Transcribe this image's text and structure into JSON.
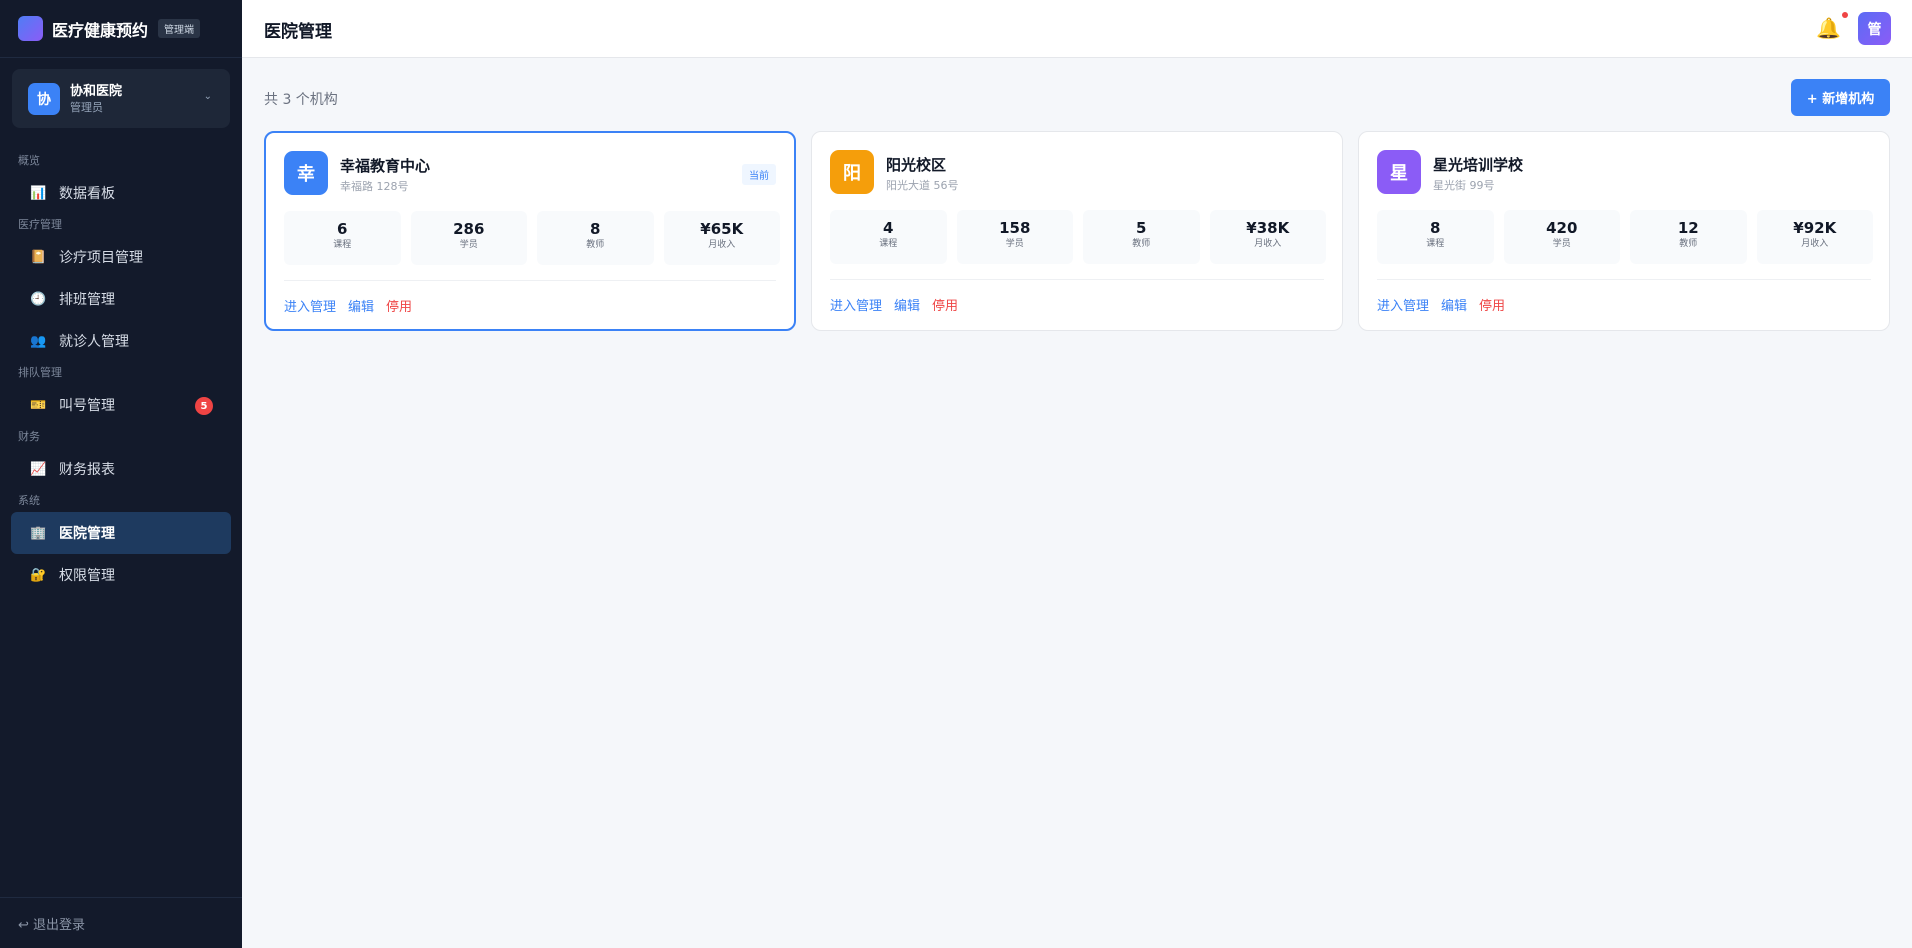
{
  "brand": {
    "name": "医疗健康预约",
    "tag": "管理端"
  },
  "org": {
    "avatar": "协",
    "name": "协和医院",
    "role": "管理员",
    "caret": "⌄"
  },
  "nav": {
    "groups": [
      {
        "label": "概览",
        "items": [
          {
            "icon": "📊",
            "icon_name": "chart-icon",
            "label": "数据看板"
          }
        ]
      },
      {
        "label": "医疗管理",
        "items": [
          {
            "icon": "📔",
            "icon_name": "notebook-icon",
            "label": "诊疗项目管理"
          },
          {
            "icon": "🕘",
            "icon_name": "clock-icon",
            "label": "排班管理"
          },
          {
            "icon": "👥",
            "icon_name": "users-icon",
            "label": "就诊人管理"
          }
        ]
      },
      {
        "label": "排队管理",
        "items": [
          {
            "icon": "🎫",
            "icon_name": "ticket-icon",
            "label": "叫号管理",
            "badge": "5"
          }
        ]
      },
      {
        "label": "财务",
        "items": [
          {
            "icon": "📈",
            "icon_name": "trend-icon",
            "label": "财务报表"
          }
        ]
      },
      {
        "label": "系统",
        "items": [
          {
            "icon": "🏢",
            "icon_name": "building-icon",
            "label": "医院管理",
            "active": true
          },
          {
            "icon": "🔐",
            "icon_name": "lock-icon",
            "label": "权限管理"
          }
        ]
      }
    ]
  },
  "logout": "↩ 退出登录",
  "header": {
    "title": "医院管理",
    "bell_icon": "🔔",
    "user_avatar": "管"
  },
  "content": {
    "count_text": "共 3 个机构",
    "add_button": "+ 新增机构",
    "cards": [
      {
        "avatar": "幸",
        "color": "#3b82f6",
        "name": "幸福教育中心",
        "address": "幸福路 128号",
        "current": true,
        "current_tag": "当前",
        "stats": [
          {
            "value": "6",
            "label": "课程"
          },
          {
            "value": "286",
            "label": "学员"
          },
          {
            "value": "8",
            "label": "教师"
          },
          {
            "value": "¥65K",
            "label": "月收入"
          }
        ]
      },
      {
        "avatar": "阳",
        "color": "#f59e0b",
        "name": "阳光校区",
        "address": "阳光大道 56号",
        "current": false,
        "current_tag": "",
        "stats": [
          {
            "value": "4",
            "label": "课程"
          },
          {
            "value": "158",
            "label": "学员"
          },
          {
            "value": "5",
            "label": "教师"
          },
          {
            "value": "¥38K",
            "label": "月收入"
          }
        ]
      },
      {
        "avatar": "星",
        "color": "#8b5cf6",
        "name": "星光培训学校",
        "address": "星光街 99号",
        "current": false,
        "current_tag": "",
        "stats": [
          {
            "value": "8",
            "label": "课程"
          },
          {
            "value": "420",
            "label": "学员"
          },
          {
            "value": "12",
            "label": "教师"
          },
          {
            "value": "¥92K",
            "label": "月收入"
          }
        ]
      }
    ],
    "actions": {
      "enter": "进入管理",
      "edit": "编辑",
      "disable": "停用"
    }
  }
}
